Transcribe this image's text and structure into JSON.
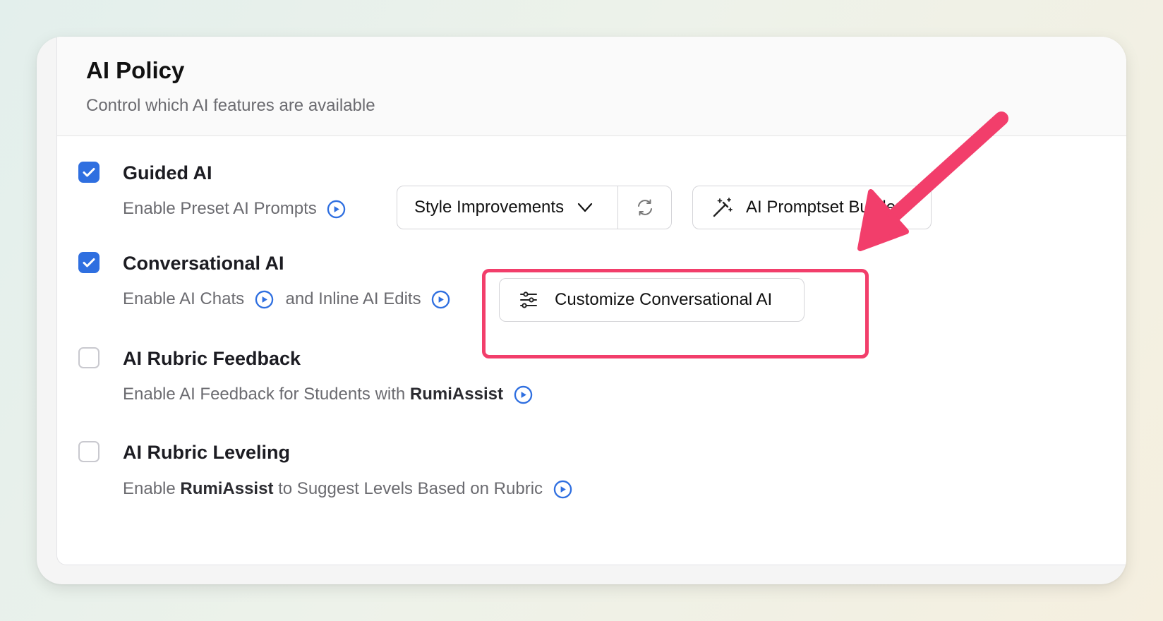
{
  "header": {
    "title": "AI Policy",
    "subtitle": "Control which AI features are available"
  },
  "options": [
    {
      "label": "Guided AI",
      "checked": true,
      "description": "Enable Preset AI Prompts"
    },
    {
      "label": "Conversational AI",
      "checked": true,
      "description_part1": "Enable AI Chats",
      "description_part2": "and Inline AI Edits"
    },
    {
      "label": "AI Rubric Feedback",
      "checked": false,
      "description_part1": "Enable AI Feedback for Students with",
      "description_bold": "RumiAssist"
    },
    {
      "label": "AI Rubric Leveling",
      "checked": false,
      "description_part1": "Enable",
      "description_bold": "RumiAssist",
      "description_part2": "to Suggest Levels Based on Rubric"
    }
  ],
  "controls": {
    "style_select_value": "Style Improvements",
    "prompts_builder_label": "AI Promptset Builder",
    "customize_label": "Customize Conversational AI"
  },
  "colors": {
    "accent": "#2f6fe0",
    "annotation": "#f23e6b"
  },
  "icons": [
    "check-icon",
    "play-circle-icon",
    "chevron-down-icon",
    "refresh-icon",
    "magic-wand-icon",
    "sliders-icon",
    "arrow-annotation"
  ]
}
